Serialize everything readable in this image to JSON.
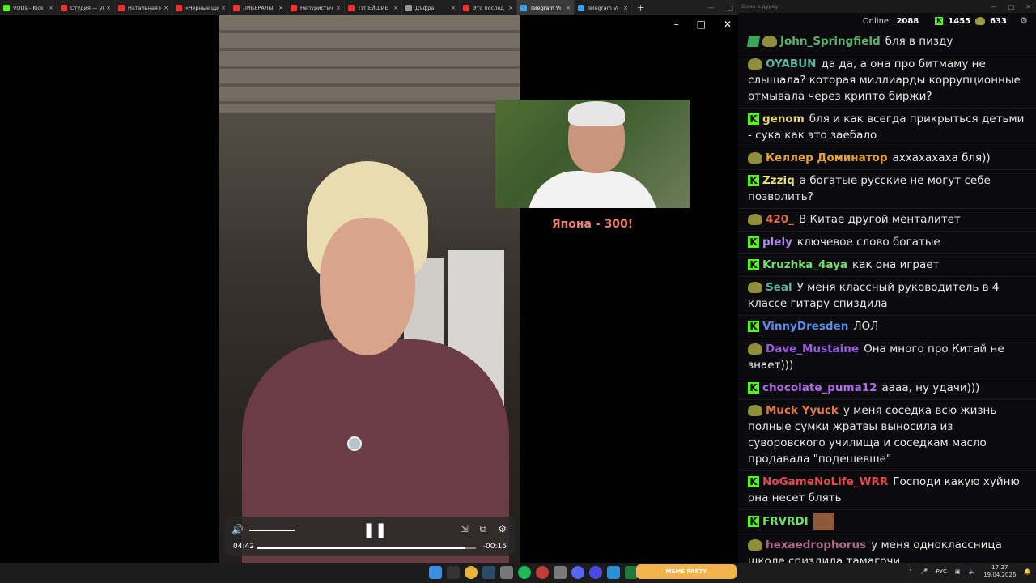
{
  "browser": {
    "tabs": [
      {
        "title": "VODs - Kick",
        "color": "#53fc18"
      },
      {
        "title": "Студия — Vi",
        "color": "#ff3030"
      },
      {
        "title": "Натальная ка",
        "color": "#ff3030"
      },
      {
        "title": "«Черные щит",
        "color": "#ff3030"
      },
      {
        "title": "ЛИБЕРАЛЫ",
        "color": "#ff3030"
      },
      {
        "title": "Непуристичн",
        "color": "#ff3030"
      },
      {
        "title": "ТУПЕЙШИЕ",
        "color": "#ff3030"
      },
      {
        "title": "Дъфра",
        "color": "#999999"
      },
      {
        "title": "Это послед",
        "color": "#ff3030"
      },
      {
        "title": "Telegram Vi",
        "color": "#3aa0e8",
        "active": true
      },
      {
        "title": "Telegram Vi",
        "color": "#3aa0e8"
      }
    ],
    "new_tab": "+"
  },
  "video": {
    "current_time": "04:42",
    "remaining_time": "-00:15",
    "volume": 0.45,
    "progress": 0.95,
    "pip_caption": "Япона - 300!"
  },
  "chat": {
    "window_title": "Окно в дурку",
    "online_label": "Online:",
    "online_count": "2088",
    "k_count": "1455",
    "p_count": "633",
    "messages": [
      {
        "badges": [
          "m",
          "p"
        ],
        "user": "John_Springfield",
        "color": "#5eb26d",
        "text": "бля в пизду"
      },
      {
        "badges": [
          "p"
        ],
        "user": "OYABUN",
        "color": "#5fb3a2",
        "text": "да да, а она про битмаму не слышала? которая миллиарды коррупционные отмывала через крипто биржи?"
      },
      {
        "badges": [
          "k"
        ],
        "user": "genom",
        "color": "#e8d47a",
        "text": "бля и как всегда прикрыться детьми - сука как это заебало"
      },
      {
        "badges": [
          "p"
        ],
        "user": "Келлер Доминатор",
        "color": "#e6a03a",
        "text": "аххахахаха бля))"
      },
      {
        "badges": [
          "k"
        ],
        "user": "Zzziq",
        "color": "#e8e070",
        "text": "а богатые русские не могут себе позволить?"
      },
      {
        "badges": [
          "p"
        ],
        "user": "420_",
        "color": "#e06a4a",
        "text": "В Китае другой менталитет"
      },
      {
        "badges": [
          "k"
        ],
        "user": "plely",
        "color": "#b08be8",
        "text": "ключевое слово богатые"
      },
      {
        "badges": [
          "k"
        ],
        "user": "Kruzhka_4aya",
        "color": "#6fe06f",
        "text": "как она играет"
      },
      {
        "badges": [
          "p"
        ],
        "user": "Seal",
        "color": "#5fb3a2",
        "text": "У меня классный руководитель в 4 классе гитару спиздила"
      },
      {
        "badges": [
          "k"
        ],
        "user": "VinnyDresden",
        "color": "#5a8be8",
        "text": "ЛОЛ"
      },
      {
        "badges": [
          "p"
        ],
        "user": "Dave_Mustaine",
        "color": "#9b5ae0",
        "text": "Она много про Китай не знает)))"
      },
      {
        "badges": [
          "k"
        ],
        "user": "chocolate_puma12",
        "color": "#b06ae8",
        "text": "аааа, ну удачи)))"
      },
      {
        "badges": [
          "p"
        ],
        "user": "Muck Yyuck",
        "color": "#e0784a",
        "text": "у меня соседка всю жизнь полные сумки жратвы выносила из суворовского училища и соседкам масло продавала \"подешевше\""
      },
      {
        "badges": [
          "k"
        ],
        "user": "NoGameNoLife_WRR",
        "color": "#e04a4a",
        "text": "Господи какую хуйню она несет блять"
      },
      {
        "badges": [
          "k"
        ],
        "user": "FRVRDI",
        "color": "#6fe06f",
        "text": "",
        "emote": true
      },
      {
        "badges": [
          "p"
        ],
        "user": "hexaedrophorus",
        "color": "#b06a8b",
        "text": "у меня одноклассница школе спиздила тамагочи"
      }
    ]
  },
  "taskbar": {
    "banner": "MEME PARTY",
    "lang": "РУС",
    "time": "17:27",
    "date": "19.04.2026"
  }
}
